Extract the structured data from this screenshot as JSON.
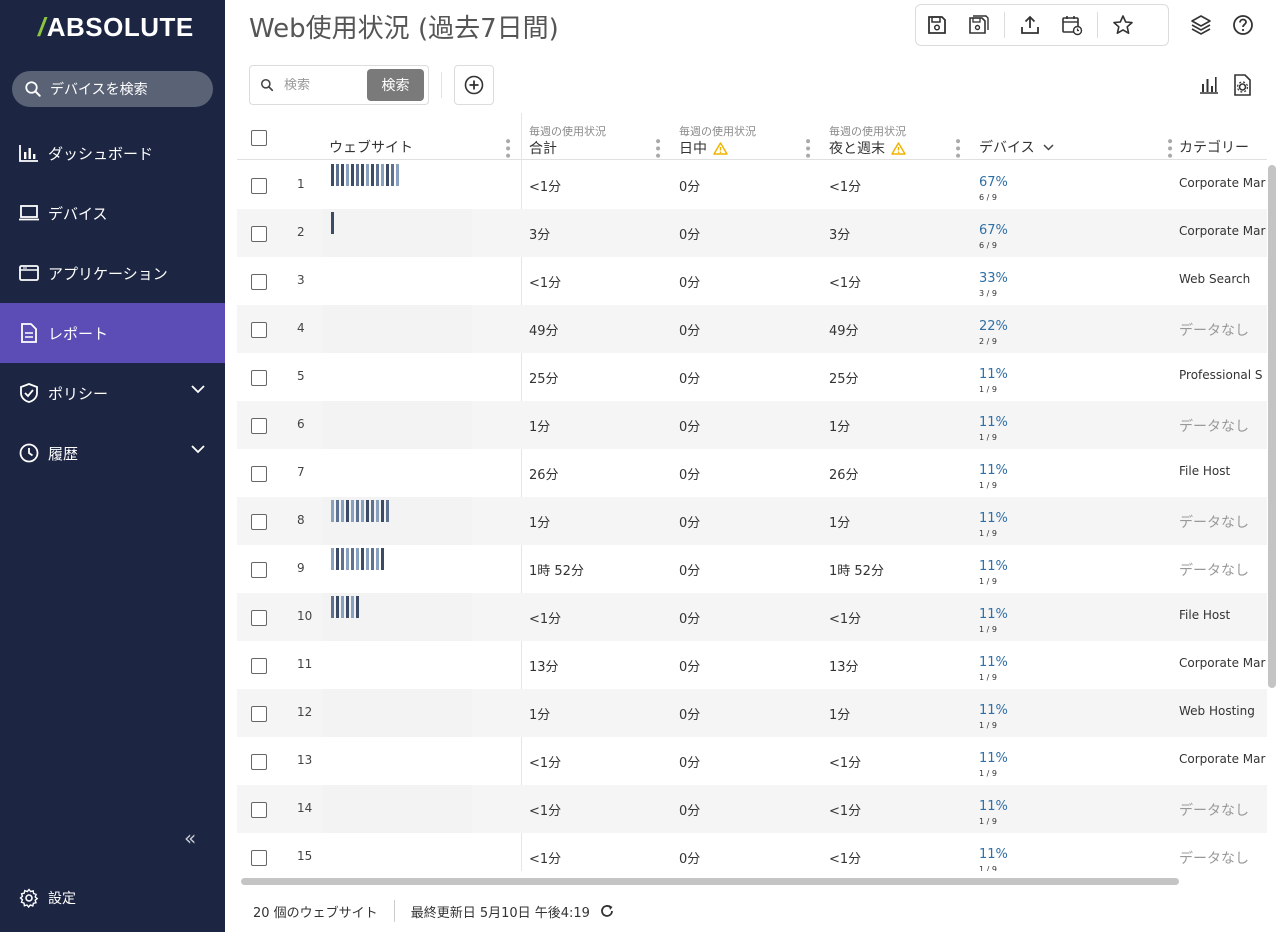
{
  "sidebar": {
    "logo": "ABSOLUTE",
    "search_device": "デバイスを検索",
    "items": [
      {
        "label": "ダッシュボード",
        "icon": "bar-chart-icon"
      },
      {
        "label": "デバイス",
        "icon": "laptop-icon"
      },
      {
        "label": "アプリケーション",
        "icon": "app-window-icon"
      },
      {
        "label": "レポート",
        "icon": "document-icon",
        "active": true
      },
      {
        "label": "ポリシー",
        "icon": "shield-icon",
        "expandable": true
      },
      {
        "label": "履歴",
        "icon": "clock-icon",
        "expandable": true
      }
    ],
    "collapse": "«",
    "settings": "設定"
  },
  "header": {
    "title": "Web使用状況 (過去7日間)"
  },
  "search": {
    "placeholder": "検索",
    "button": "検索"
  },
  "table": {
    "columns": {
      "website": "ウェブサイト",
      "total_sub": "毎週の使用状況",
      "total": "合計",
      "day_sub": "毎週の使用状況",
      "day": "日中",
      "night_sub": "毎週の使用状況",
      "night": "夜と週末",
      "devices": "デバイス",
      "category": "カテゴリー"
    },
    "rows": [
      {
        "n": "1",
        "total": "<1分",
        "day": "0分",
        "night": "<1分",
        "pct": "67%",
        "frac": "6 / 9",
        "category": "Corporate Mar",
        "nodata": false
      },
      {
        "n": "2",
        "total": "3分",
        "day": "0分",
        "night": "3分",
        "pct": "67%",
        "frac": "6 / 9",
        "category": "Corporate Mar",
        "nodata": false
      },
      {
        "n": "3",
        "total": "<1分",
        "day": "0分",
        "night": "<1分",
        "pct": "33%",
        "frac": "3 / 9",
        "category": "Web Search",
        "nodata": false
      },
      {
        "n": "4",
        "total": "49分",
        "day": "0分",
        "night": "49分",
        "pct": "22%",
        "frac": "2 / 9",
        "category": "データなし",
        "nodata": true
      },
      {
        "n": "5",
        "total": "25分",
        "day": "0分",
        "night": "25分",
        "pct": "11%",
        "frac": "1 / 9",
        "category": "Professional S",
        "nodata": false
      },
      {
        "n": "6",
        "total": "1分",
        "day": "0分",
        "night": "1分",
        "pct": "11%",
        "frac": "1 / 9",
        "category": "データなし",
        "nodata": true
      },
      {
        "n": "7",
        "total": "26分",
        "day": "0分",
        "night": "26分",
        "pct": "11%",
        "frac": "1 / 9",
        "category": "File Host",
        "nodata": false
      },
      {
        "n": "8",
        "total": "1分",
        "day": "0分",
        "night": "1分",
        "pct": "11%",
        "frac": "1 / 9",
        "category": "データなし",
        "nodata": true
      },
      {
        "n": "9",
        "total": "1時 52分",
        "day": "0分",
        "night": "1時 52分",
        "pct": "11%",
        "frac": "1 / 9",
        "category": "データなし",
        "nodata": true
      },
      {
        "n": "10",
        "total": "<1分",
        "day": "0分",
        "night": "<1分",
        "pct": "11%",
        "frac": "1 / 9",
        "category": "File Host",
        "nodata": false
      },
      {
        "n": "11",
        "total": "13分",
        "day": "0分",
        "night": "13分",
        "pct": "11%",
        "frac": "1 / 9",
        "category": "Corporate Mar",
        "nodata": false
      },
      {
        "n": "12",
        "total": "1分",
        "day": "0分",
        "night": "1分",
        "pct": "11%",
        "frac": "1 / 9",
        "category": "Web Hosting",
        "nodata": false
      },
      {
        "n": "13",
        "total": "<1分",
        "day": "0分",
        "night": "<1分",
        "pct": "11%",
        "frac": "1 / 9",
        "category": "Corporate Mar",
        "nodata": false
      },
      {
        "n": "14",
        "total": "<1分",
        "day": "0分",
        "night": "<1分",
        "pct": "11%",
        "frac": "1 / 9",
        "category": "データなし",
        "nodata": true
      },
      {
        "n": "15",
        "total": "<1分",
        "day": "0分",
        "night": "<1分",
        "pct": "11%",
        "frac": "1 / 9",
        "category": "データなし",
        "nodata": true
      }
    ]
  },
  "footer": {
    "count": "20 個のウェブサイト",
    "updated": "最終更新日 5月10日 午後4:19"
  },
  "colors": {
    "sidebar_bg": "#1c2541",
    "active_nav": "#5b4db5",
    "link": "#2f6fa6",
    "warning": "#f0b400"
  }
}
